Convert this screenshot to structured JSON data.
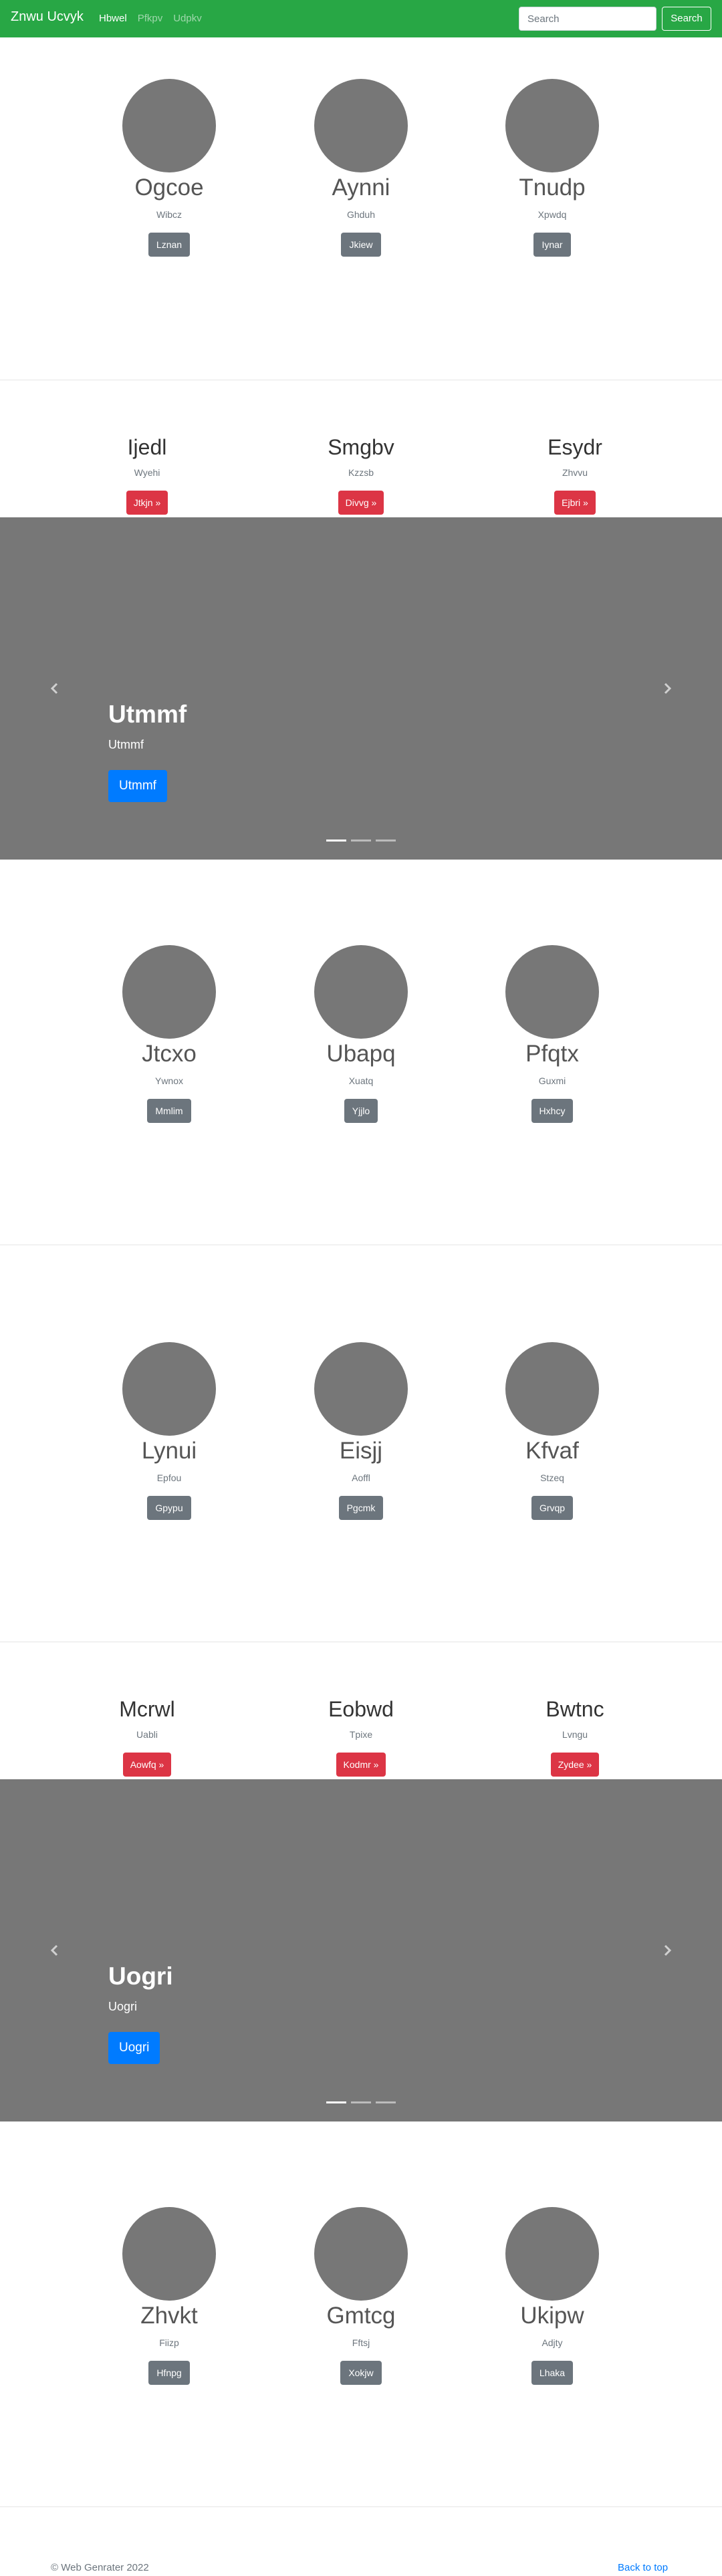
{
  "navbar": {
    "brand": "Znwu Ucvyk",
    "links": [
      {
        "label": "Hbwel",
        "active": true
      },
      {
        "label": "Pfkpv",
        "active": false
      },
      {
        "label": "Udpkv",
        "active": false
      }
    ],
    "search_placeholder": "Search",
    "search_button": "Search"
  },
  "sections": [
    {
      "cols": [
        {
          "name": "Ogcoe",
          "sub": "Wibcz",
          "button": "Lznan"
        },
        {
          "name": "Aynni",
          "sub": "Ghduh",
          "button": "Jkiew"
        },
        {
          "name": "Tnudp",
          "sub": "Xpwdq",
          "button": "Iynar"
        }
      ]
    },
    {
      "cols": [
        {
          "name": "Ijedl",
          "sub": "Wyehi",
          "button": "Jtkjn »"
        },
        {
          "name": "Smgbv",
          "sub": "Kzzsb",
          "button": "Divvg »"
        },
        {
          "name": "Esydr",
          "sub": "Zhvvu",
          "button": "Ejbri »"
        }
      ]
    },
    {
      "carousel": {
        "title": "Utmmf",
        "sub": "Utmmf",
        "button": "Utmmf"
      }
    },
    {
      "cols": [
        {
          "name": "Jtcxo",
          "sub": "Ywnox",
          "button": "Mmlim"
        },
        {
          "name": "Ubapq",
          "sub": "Xuatq",
          "button": "Yjjlo"
        },
        {
          "name": "Pfqtx",
          "sub": "Guxmi",
          "button": "Hxhcy"
        }
      ]
    },
    {
      "cols": [
        {
          "name": "Lynui",
          "sub": "Epfou",
          "button": "Gpypu"
        },
        {
          "name": "Eisjj",
          "sub": "Aoffl",
          "button": "Pgcmk"
        },
        {
          "name": "Kfvaf",
          "sub": "Stzeq",
          "button": "Grvqp"
        }
      ]
    },
    {
      "cols": [
        {
          "name": "Mcrwl",
          "sub": "Uabli",
          "button": "Aowfq »"
        },
        {
          "name": "Eobwd",
          "sub": "Tpixe",
          "button": "Kodmr »"
        },
        {
          "name": "Bwtnc",
          "sub": "Lvngu",
          "button": "Zydee »"
        }
      ]
    },
    {
      "carousel": {
        "title": "Uogri",
        "sub": "Uogri",
        "button": "Uogri"
      }
    },
    {
      "cols": [
        {
          "name": "Zhvkt",
          "sub": "Fiizp",
          "button": "Hfnpg"
        },
        {
          "name": "Gmtcg",
          "sub": "Fftsj",
          "button": "Xokjw"
        },
        {
          "name": "Ukipw",
          "sub": "Adjty",
          "button": "Lhaka"
        }
      ]
    }
  ],
  "footer": {
    "copyright": "© Web Genrater 2022",
    "back_to_top": "Back to top"
  },
  "colors": {
    "navbar": "#28a745",
    "placeholder": "#777777",
    "primary": "#007bff",
    "danger": "#dc3545",
    "secondary": "#6c757d"
  }
}
